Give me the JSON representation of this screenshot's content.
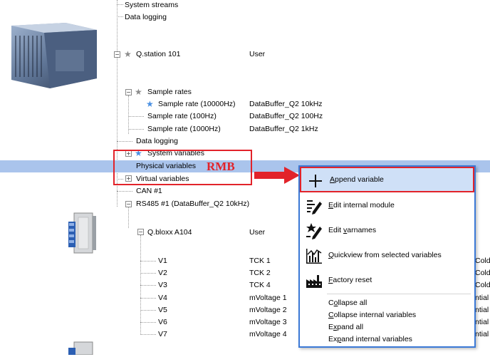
{
  "tree": {
    "top_items": [
      {
        "label": "System streams"
      },
      {
        "label": "Data logging"
      }
    ],
    "station": {
      "label": "Q.station 101",
      "value": "User"
    },
    "sample_rates": {
      "label": "Sample rates",
      "items": [
        {
          "label": "Sample rate (10000Hz)",
          "value": "DataBuffer_Q2 10kHz"
        },
        {
          "label": "Sample rate (100Hz)",
          "value": "DataBuffer_Q2 100Hz"
        },
        {
          "label": "Sample rate (1000Hz)",
          "value": "DataBuffer_Q2 1kHz"
        }
      ]
    },
    "data_logging": {
      "label": "Data logging"
    },
    "system_variables": {
      "label": "System variables"
    },
    "physical_variables": {
      "label": "Physical variables"
    },
    "virtual_variables": {
      "label": "Virtual variables"
    },
    "can": {
      "label": "CAN #1"
    },
    "rs485": {
      "label": "RS485 #1 (DataBuffer_Q2 10kHz)"
    },
    "bloxx": {
      "label": "Q.bloxx A104",
      "value": "User"
    },
    "variables": [
      {
        "name": "V1",
        "value": "TCK 1",
        "extra": "Cold-"
      },
      {
        "name": "V2",
        "value": "TCK 2",
        "extra": "Cold-"
      },
      {
        "name": "V3",
        "value": "TCK 4",
        "extra": "Cold-"
      },
      {
        "name": "V4",
        "value": "mVoltage 1",
        "extra": "ntial"
      },
      {
        "name": "V5",
        "value": "mVoltage 2",
        "extra": "ntial"
      },
      {
        "name": "V6",
        "value": "mVoltage 3",
        "extra": "ntial"
      },
      {
        "name": "V7",
        "value": "mVoltage 4",
        "extra": "ntial"
      }
    ]
  },
  "annotation": {
    "rmb_label": "RMB",
    "color": "#e2232a"
  },
  "context_menu": {
    "items": [
      {
        "label": "Append variable",
        "icon": "plus-icon"
      },
      {
        "label": "Edit internal module",
        "icon": "edit-module-icon"
      },
      {
        "label": "Edit varnames",
        "icon": "edit-varnames-icon"
      },
      {
        "label": "Quickview from selected variables",
        "icon": "quickview-chart-icon"
      },
      {
        "label": "Factory reset",
        "icon": "factory-icon"
      }
    ],
    "text_items": [
      {
        "label": "Collapse all"
      },
      {
        "label": "Collapse internal variables"
      },
      {
        "label": "Expand all"
      },
      {
        "label": "Expand internal variables"
      }
    ]
  },
  "colors": {
    "selection": "#aac4ec",
    "menu_border": "#3b79d6",
    "accent_red": "#e2232a"
  }
}
